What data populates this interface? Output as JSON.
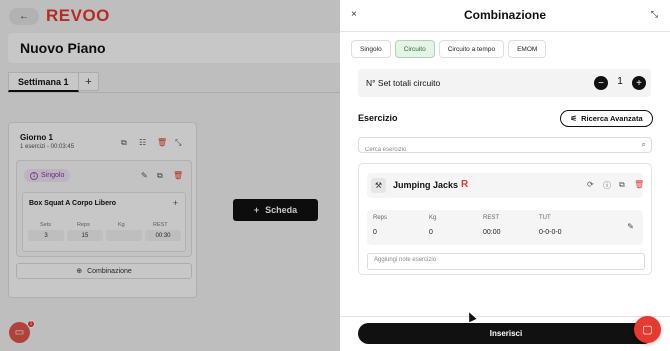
{
  "app": {
    "logo": "REVOO",
    "back_icon": "←",
    "plan_title": "Nuovo Piano",
    "week_tab": "Settimana 1",
    "week_add": "+",
    "day": {
      "title": "Giorno 1",
      "subtitle": "1 esercizi - 00:03:45",
      "group": {
        "type_num": "1",
        "type_label": "Singolo",
        "exercise": {
          "name": "Box Squat A Corpo Libero",
          "plus": "+",
          "headers": [
            "Sets",
            "Reps",
            "Kg",
            "REST"
          ],
          "values": [
            "3",
            "15",
            "",
            "00:30"
          ]
        }
      },
      "combination_label": "Combinazione"
    },
    "scheda_label": "Scheda",
    "chat_badge": "1"
  },
  "panel": {
    "title": "Combinazione",
    "close_icon": "×",
    "collapse_icon": "⤡",
    "type_tabs": [
      "Singolo",
      "Circuito",
      "Circuito a tempo",
      "EMOM"
    ],
    "active_tab": "Circuito",
    "sets_label": "N° Set totali circuito",
    "sets_value": "1",
    "minus": "−",
    "plus": "+",
    "exercise_section_title": "Esercizio",
    "advanced_search_label": "Ricerca Avanzata",
    "search_placeholder": "Cerca esercizio",
    "exercise": {
      "name": "Jumping Jacks",
      "flag": "R",
      "stats_headers": [
        "Reps",
        "Kg",
        "REST",
        "TUT"
      ],
      "stats_values": [
        "0",
        "0",
        "00:00",
        "0-0-0-0"
      ],
      "notes_placeholder": "Aggiungi note esercizio"
    },
    "insert_label": "Inserisci"
  },
  "colors": {
    "brand_red": "#e63a30",
    "active_tab_bg": "#e6f4e8",
    "type_pill_bg": "#f1e6f8"
  }
}
